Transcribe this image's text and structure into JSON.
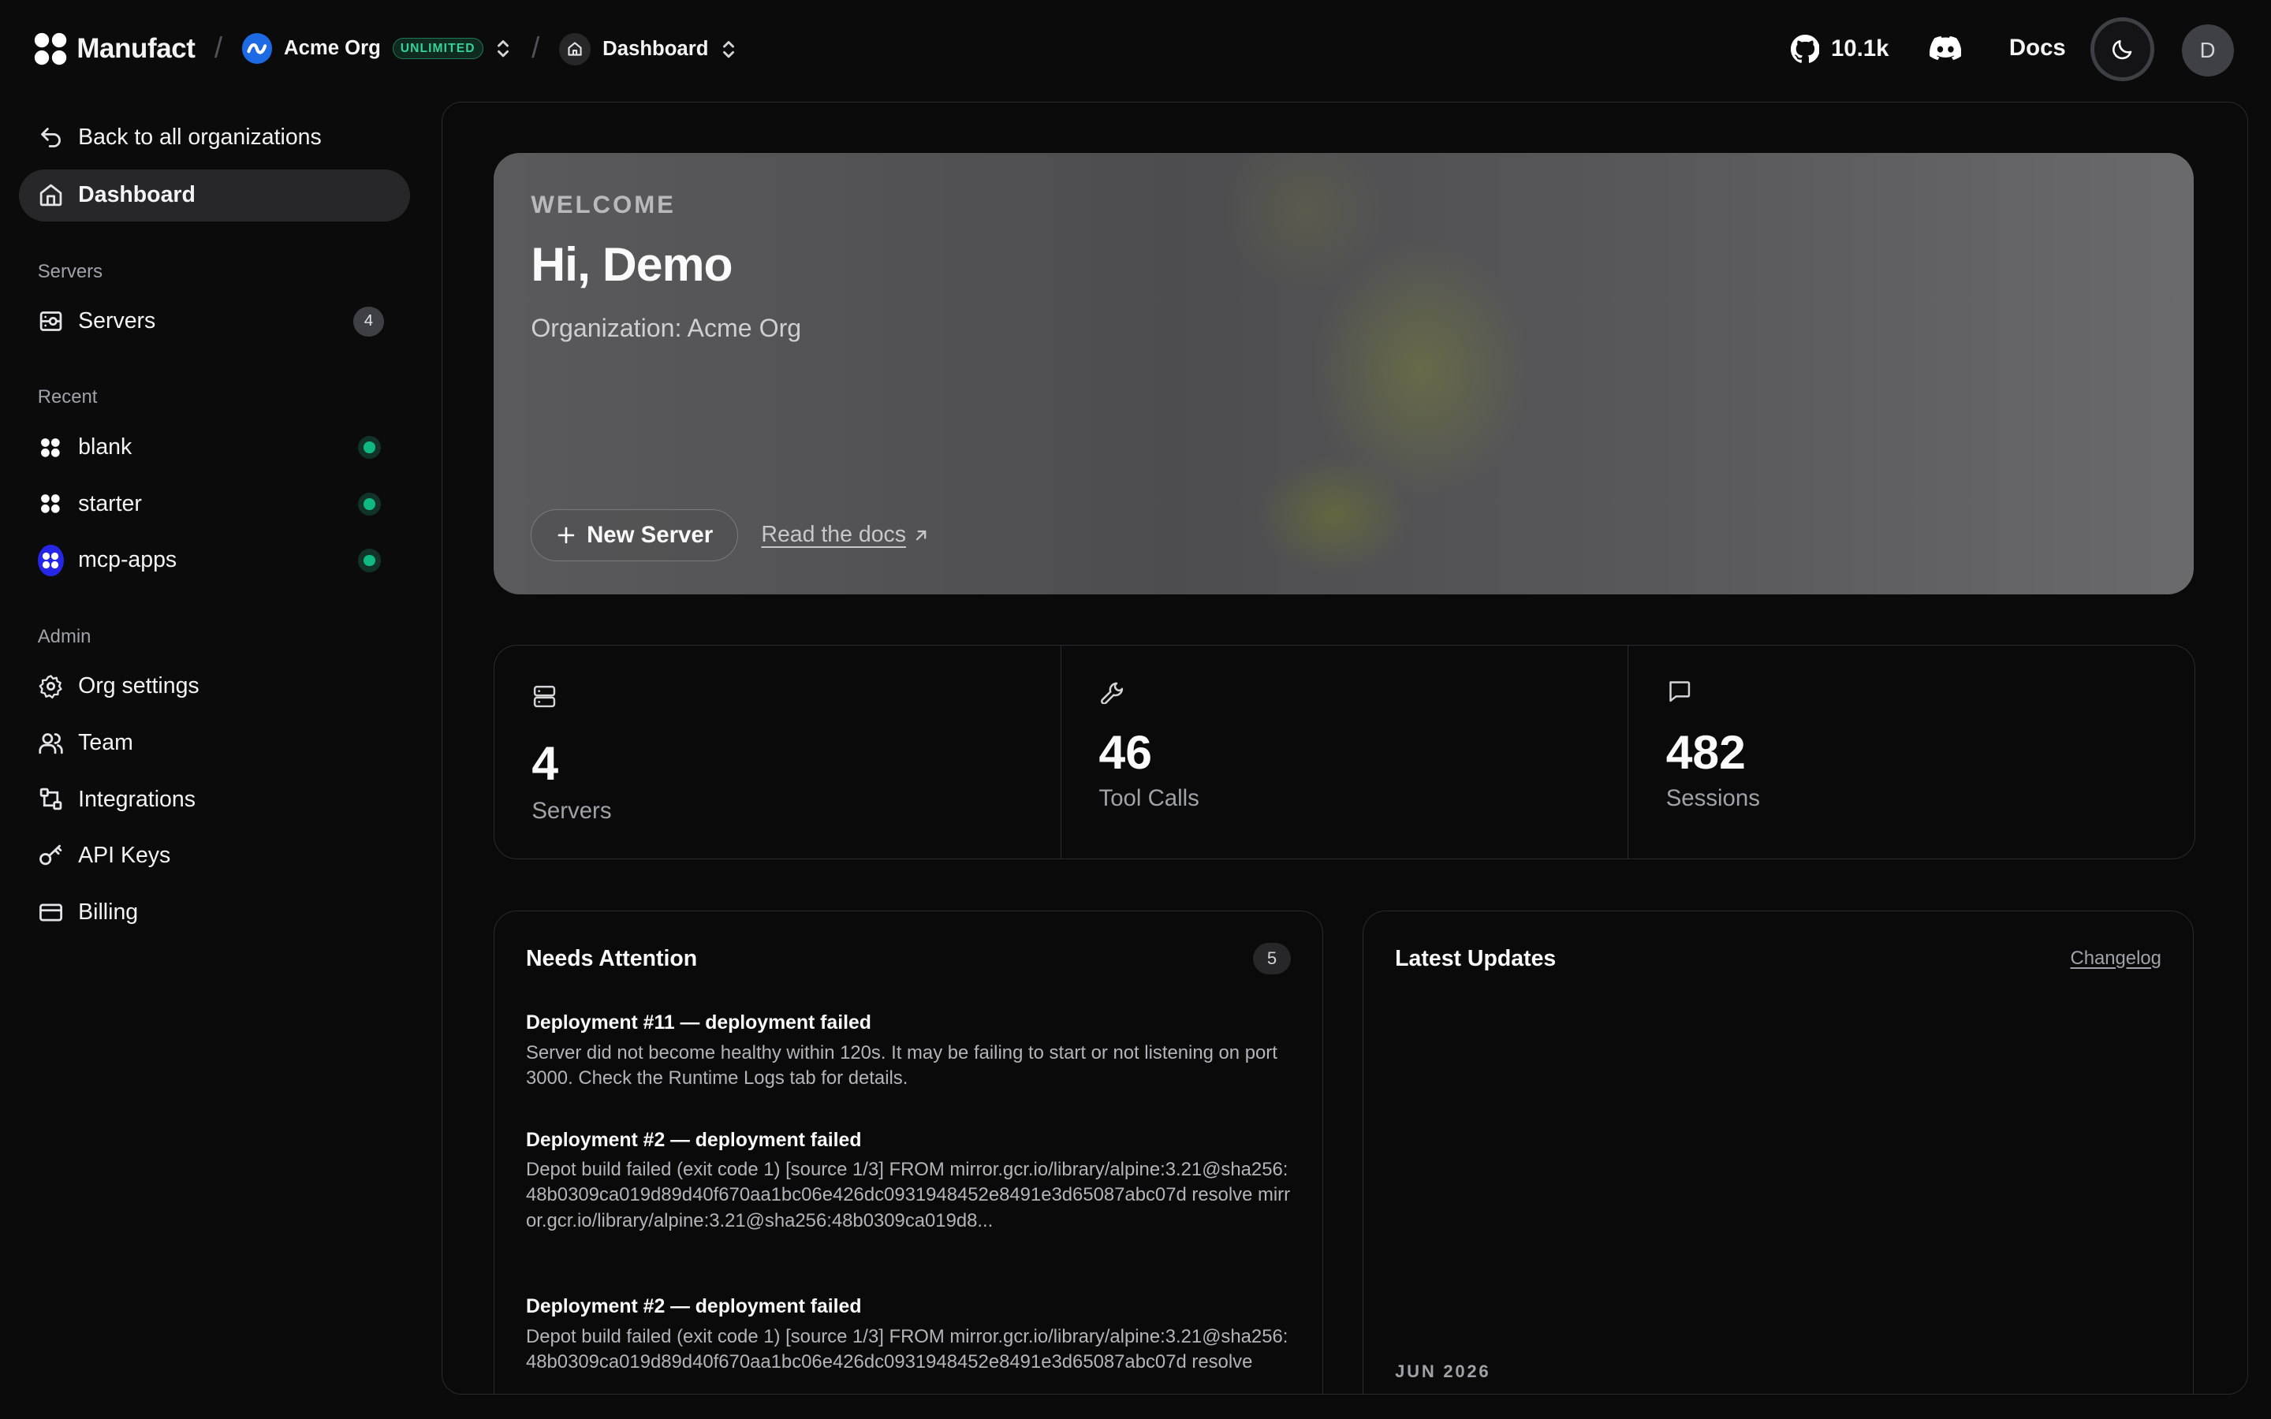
{
  "topbar": {
    "brand": "Manufact",
    "separator": "/",
    "org_name": "Acme Org",
    "plan_badge": "UNLIMITED",
    "page_name": "Dashboard",
    "github_stars": "10.1k",
    "docs_label": "Docs",
    "user_initial": "D"
  },
  "sidebar": {
    "back_label": "Back to all organizations",
    "dashboard_label": "Dashboard",
    "servers_heading": "Servers",
    "servers_label": "Servers",
    "servers_count": "4",
    "recent_heading": "Recent",
    "recent": [
      {
        "name": "blank",
        "status": "running"
      },
      {
        "name": "starter",
        "status": "running"
      },
      {
        "name": "mcp-apps",
        "status": "running"
      }
    ],
    "admin_heading": "Admin",
    "admin": [
      {
        "label": "Org settings",
        "icon": "gear-icon"
      },
      {
        "label": "Team",
        "icon": "users-icon"
      },
      {
        "label": "Integrations",
        "icon": "integrations-icon"
      },
      {
        "label": "API Keys",
        "icon": "key-icon"
      },
      {
        "label": "Billing",
        "icon": "credit-card-icon"
      }
    ]
  },
  "hero": {
    "eyebrow": "WELCOME",
    "title": "Hi, Demo",
    "subtitle": "Organization: Acme Org",
    "new_server_label": "New Server",
    "read_docs_label": "Read the docs"
  },
  "stats": [
    {
      "value": "4",
      "label": "Servers",
      "icon": "server-icon"
    },
    {
      "value": "46",
      "label": "Tool Calls",
      "icon": "wrench-icon"
    },
    {
      "value": "482",
      "label": "Sessions",
      "icon": "message-icon"
    }
  ],
  "attention": {
    "title": "Needs Attention",
    "count": "5",
    "items": [
      {
        "title": "Deployment #11 — deployment failed",
        "body": "Server did not become healthy within 120s. It may be failing to start or not listening on port 3000. Check the Runtime Logs tab for details."
      },
      {
        "title": "Deployment #2 — deployment failed",
        "body": "Depot build failed (exit code 1) [source 1/3] FROM mirror.gcr.io/library/alpine:3.21@sha256:48b0309ca019d89d40f670aa1bc06e426dc0931948452e8491e3d65087abc07d resolve mirror.gcr.io/library/alpine:3.21@sha256:48b0309ca019d8..."
      },
      {
        "title": "Deployment #2 — deployment failed",
        "body": "Depot build failed (exit code 1) [source 1/3] FROM mirror.gcr.io/library/alpine:3.21@sha256:48b0309ca019d89d40f670aa1bc06e426dc0931948452e8491e3d65087abc07d resolve"
      }
    ]
  },
  "updates": {
    "title": "Latest Updates",
    "changelog_label": "Changelog",
    "month": "JUN 2026"
  },
  "colors": {
    "accent_green": "#10b981",
    "org_blue": "#1d6ae5",
    "mcp_apps_blue": "#2626e8"
  }
}
